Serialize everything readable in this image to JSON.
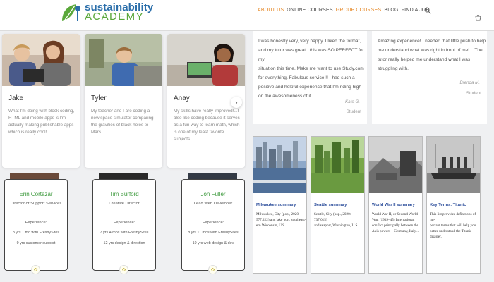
{
  "header": {
    "logo_line1": "sustainability",
    "logo_line2": "ACADEMY",
    "nav": [
      {
        "label": "ABOUT US",
        "active": true
      },
      {
        "label": "ONLINE COURSES",
        "active": false
      },
      {
        "label": "GROUP COURSES",
        "active": true
      },
      {
        "label": "BLOG",
        "active": false
      },
      {
        "label": "FIND A JOB",
        "active": false
      }
    ],
    "icons": [
      "search-icon",
      "cart-icon"
    ],
    "accent_color": "#e4821c"
  },
  "students": [
    {
      "name": "Jake",
      "quote": "What I'm doing with block coding, HTML and mobile apps is I'm actually making publishable apps which is really cool!"
    },
    {
      "name": "Tyler",
      "quote": "My teacher and I are coding a new space simulator comparing the gravities of black holes to Mars."
    },
    {
      "name": "Anay",
      "quote": "My skills have really improved!...I also like coding because it serves as a fun way to learn math, which is one of my least favorite subjects."
    }
  ],
  "next_button_icon": "chevron-right-icon",
  "staff": [
    {
      "name": "Erin Cortazar",
      "role": "Director of Support Services",
      "exp_label": "Experience:",
      "line1": "8 yrs 1 mo with FreshySites",
      "line2": "9 yrs customer support"
    },
    {
      "name": "Tim Burford",
      "role": "Creative Director",
      "exp_label": "Experience:",
      "line1": "7 yrs 4 mos with FreshySites",
      "line2": "12 yrs design & direction"
    },
    {
      "name": "Jon Fuller",
      "role": "Lead Web Developer",
      "exp_label": "Experience:",
      "line1": "8 yrs 11 mos with FreshySites",
      "line2": "19 yrs web design & dev"
    }
  ],
  "testimonials": [
    {
      "lines": [
        "I was honestly very, very happy. I liked the format,",
        "and my tutor was great...this was SO PERFECT for my",
        "situation this time. Make me want to use Study.com",
        "for everything. Fabulous service!!! I had such a",
        "positive and helpful experience that I'm riding high",
        "on the awesomeness of it."
      ],
      "author": "Kate G.",
      "role": "Student"
    },
    {
      "lines": [
        "Amazing experience! I needed that little push to help",
        "me understand what was right in front of me!... The",
        "tutor really helped me understand what I was",
        "struggling with."
      ],
      "author": "Brenda M.",
      "role": "Student"
    }
  ],
  "summaries": [
    {
      "title": "Milwaukee summary",
      "lines": [
        "Milwaukee, City (pop., 2020:",
        "577,222) and lake port, southeast-",
        "ern Wisconsin, U.S."
      ]
    },
    {
      "title": "Seattle summary",
      "lines": [
        "Seattle, City (pop., 2020: 737,015)",
        "and seaport, Washington, U.S."
      ]
    },
    {
      "title": "World War II summary",
      "lines": [
        "World War II, or Second World",
        "War, (1939–45) International",
        "conflict principally between the",
        "Axis powers—Germany, Italy,..."
      ]
    },
    {
      "title": "Key Terms: Titanic",
      "lines": [
        "This list provides definitions of im-",
        "portant terms that will help you",
        "better understand the Titanic",
        "disaster."
      ]
    }
  ]
}
